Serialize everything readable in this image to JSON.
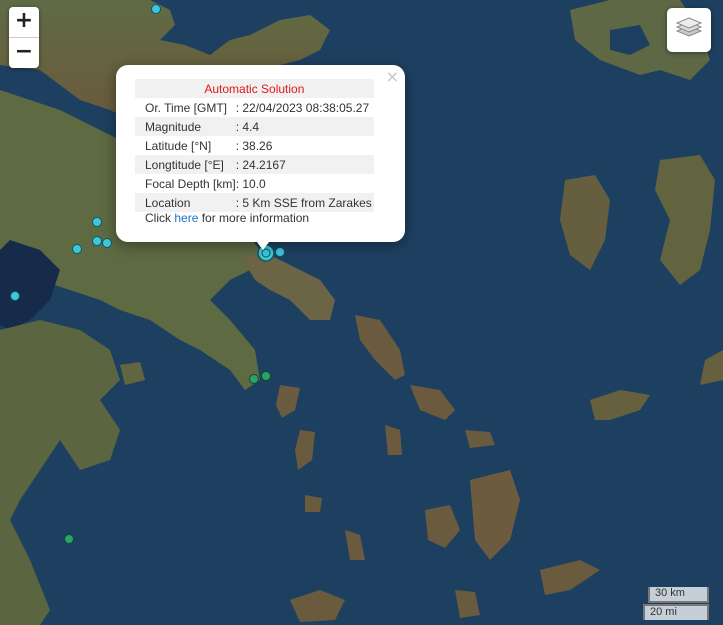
{
  "map": {
    "water_color": "#1d3f5a",
    "land_color": "#5a6a3e",
    "zoom_in_label": "+",
    "zoom_out_label": "−",
    "layers_icon": "layers-icon"
  },
  "popup": {
    "close_label": "×",
    "title": "Automatic Solution",
    "rows": [
      {
        "label": "Or. Time [GMT]",
        "value": ": 22/04/2023 08:38:05.27"
      },
      {
        "label": "Magnitude",
        "value": ": 4.4"
      },
      {
        "label": "Latitude [°N]",
        "value": ": 38.26"
      },
      {
        "label": "Longtitude [°E]",
        "value": ": 24.2167"
      },
      {
        "label": "Focal Depth [km]",
        "value": ": 10.0"
      },
      {
        "label": "Location",
        "value": ": 5 Km SSE from Zarakes"
      }
    ],
    "more_prefix": "Click ",
    "more_link": "here",
    "more_suffix": " for more information",
    "title_color": "#e0181b"
  },
  "scale": {
    "km": "30 km",
    "mi": "20 mi"
  },
  "markers": {
    "recent_color": "#3fc7d8",
    "older_color": "#2aa36a"
  }
}
